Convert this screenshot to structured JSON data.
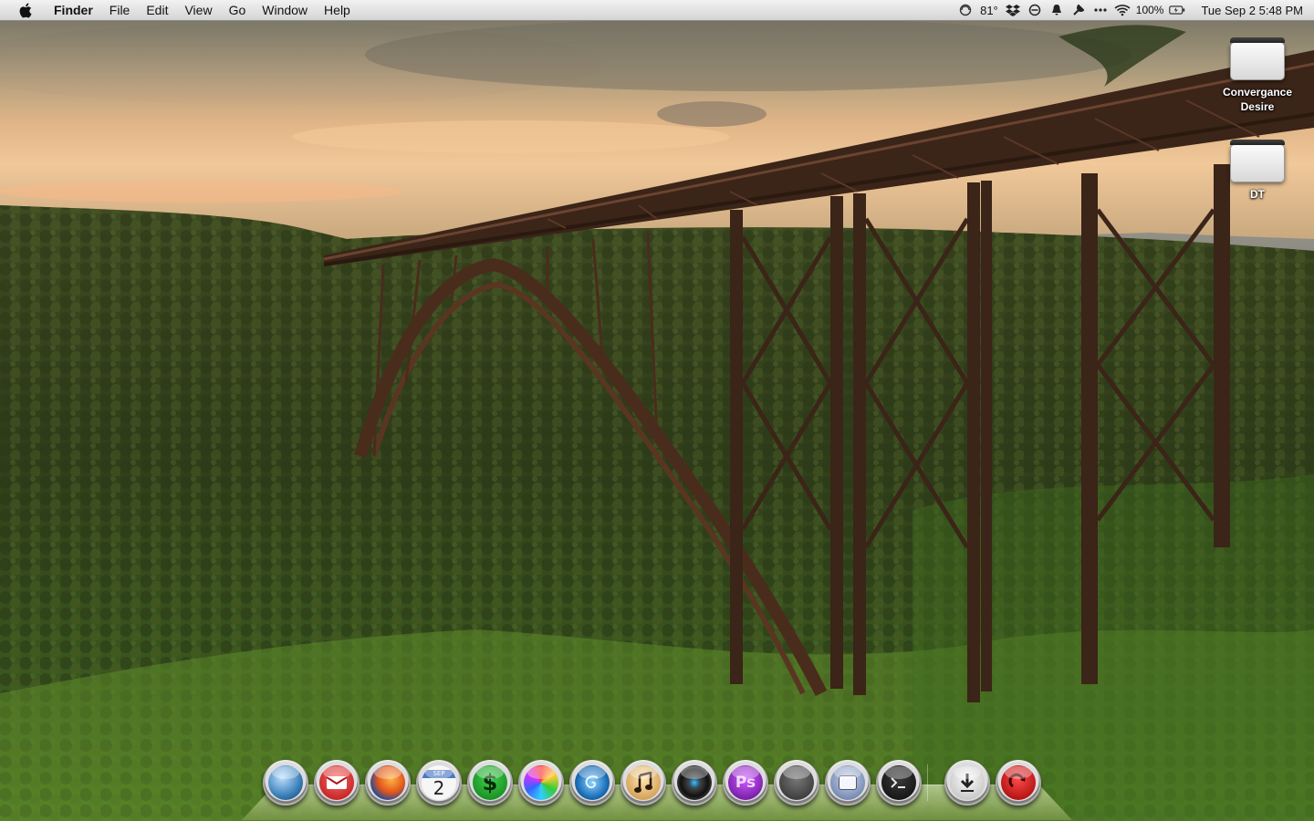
{
  "menubar": {
    "app_name": "Finder",
    "menus": [
      "File",
      "Edit",
      "View",
      "Go",
      "Window",
      "Help"
    ],
    "status": {
      "temperature": "81°",
      "battery": "100%",
      "datetime": "Tue Sep 2  5:48 PM"
    }
  },
  "desktop": {
    "icons": [
      {
        "label": "Convergance Desire",
        "icon": "hard-drive-icon"
      },
      {
        "label": "DT",
        "icon": "hard-drive-icon"
      }
    ]
  },
  "dock": {
    "items": [
      "globe",
      "mail",
      "firefox",
      "calendar",
      "money",
      "color-wheel",
      "spiral",
      "itunes",
      "camera",
      "photoshop",
      "dark-orb",
      "preview",
      "terminal",
      "downloads",
      "redo"
    ],
    "calendar": {
      "month": "SEP",
      "day": "2"
    },
    "photoshop": {
      "label": "Ps"
    },
    "money": {
      "label": "$"
    }
  },
  "colors": {
    "menubar": "#e6e6e6",
    "dock_shelf": "#9db26a"
  }
}
